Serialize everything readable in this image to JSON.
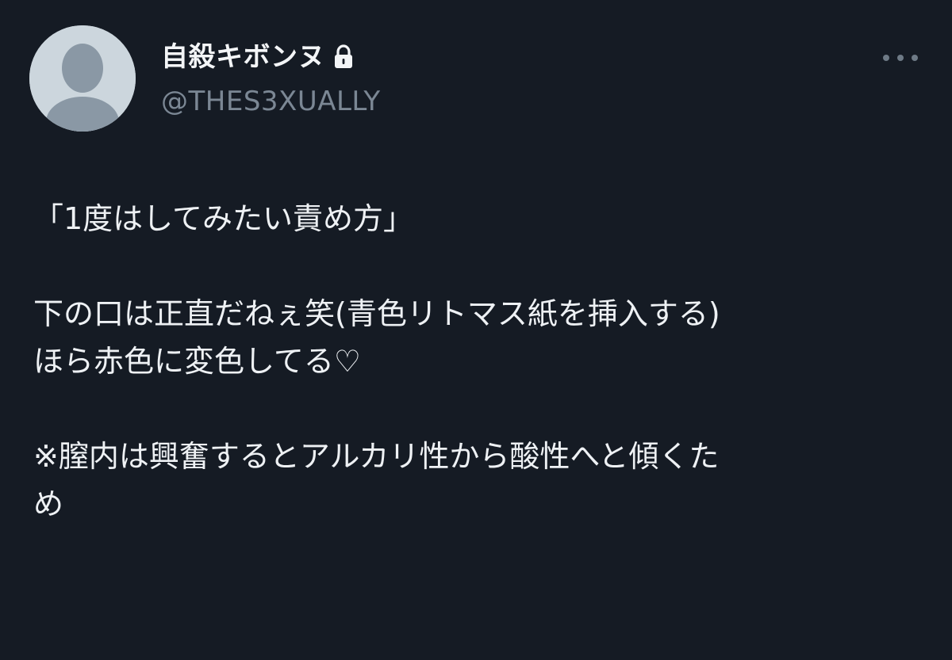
{
  "post": {
    "author": {
      "display_name": "自殺キボンヌ",
      "handle": "@THES3XUALLY",
      "protected_icon": "lock-icon",
      "avatar_icon": "default-avatar-icon"
    },
    "menu": {
      "icon": "more-options-icon"
    },
    "text_lines": [
      "「1度はしてみたい責め方」",
      "",
      "下の口は正直だねぇ笑(青色リトマス紙を挿入する)",
      "ほら赤色に変色してる♡",
      "",
      "※膣内は興奮するとアルカリ性から酸性へと傾くた",
      "め"
    ]
  },
  "colors": {
    "background": "#151b24",
    "text": "#eef1f4",
    "handle_text": "#7b8794",
    "avatar_bg": "#ccd6dd",
    "avatar_figure": "#8a98a5"
  }
}
